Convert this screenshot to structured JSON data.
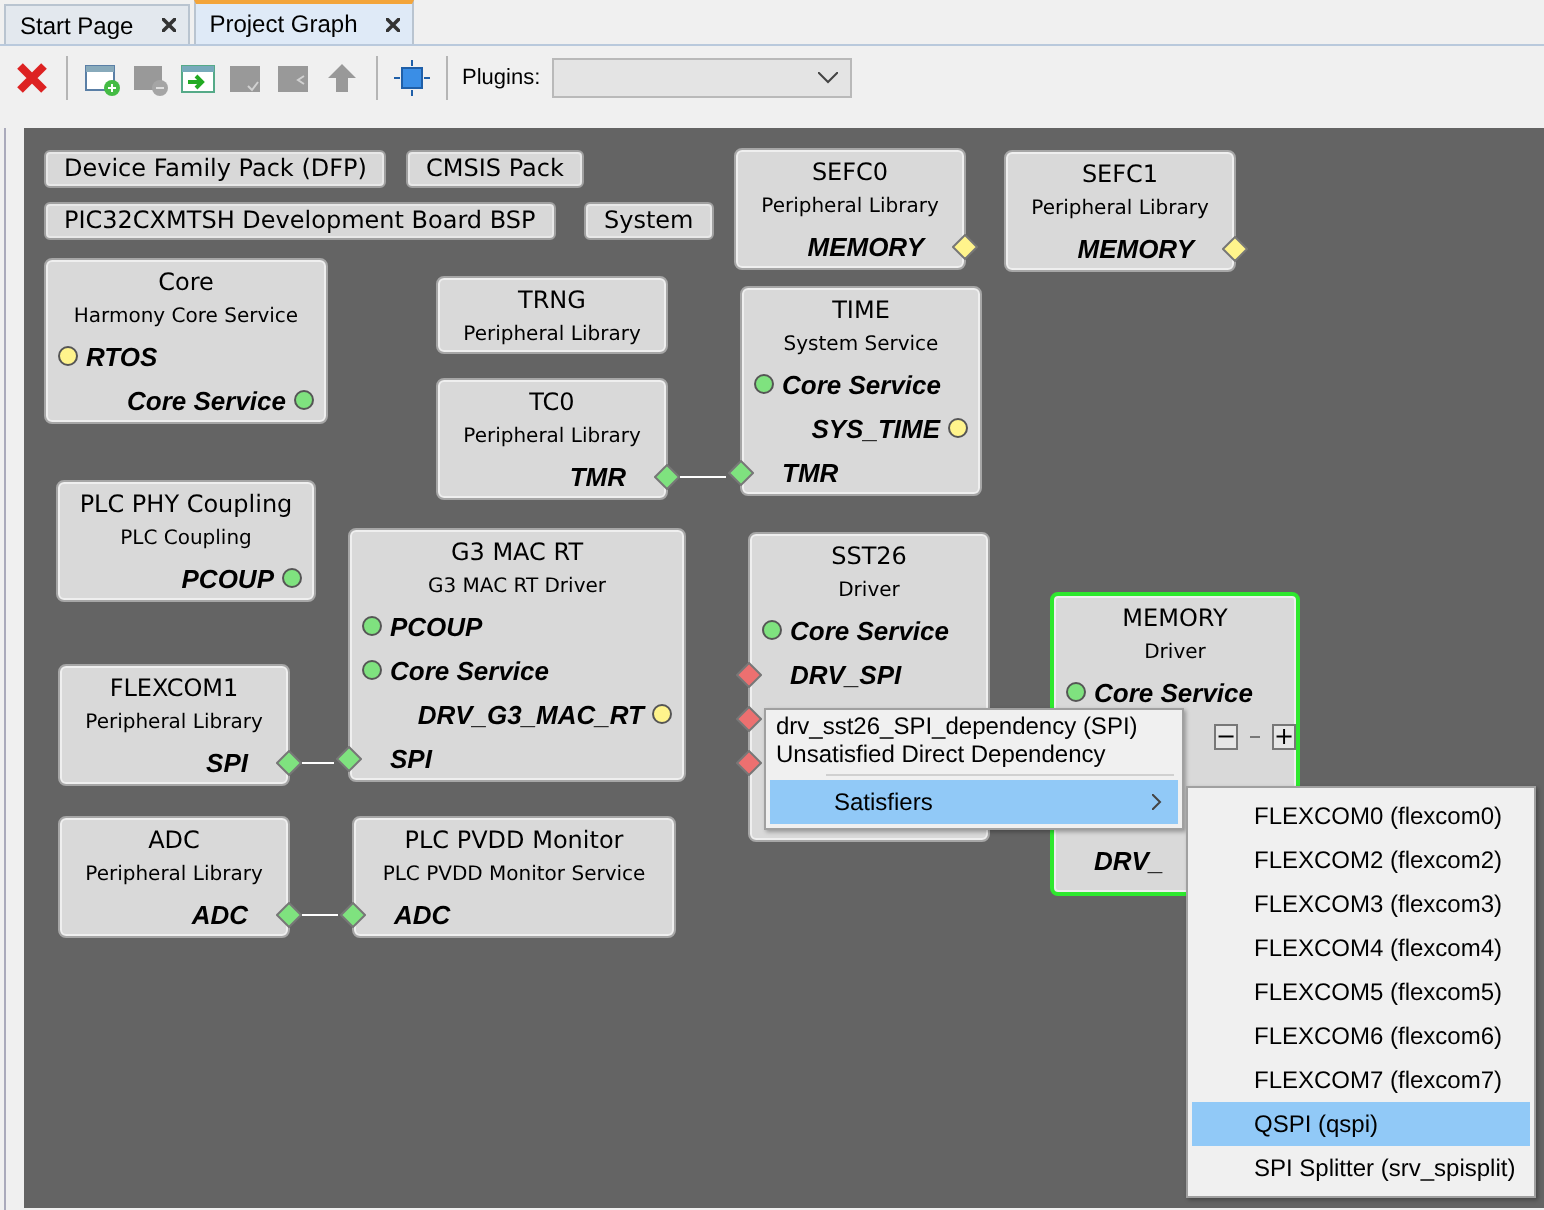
{
  "tabs": [
    {
      "label": "Start Page",
      "selected": false
    },
    {
      "label": "Project Graph",
      "selected": true
    }
  ],
  "toolbar": {
    "buttons": [
      {
        "kind": "delete",
        "disabled": false
      },
      {
        "kind": "add-window",
        "disabled": false
      },
      {
        "kind": "remove-window",
        "disabled": true
      },
      {
        "kind": "import-window",
        "disabled": false
      },
      {
        "kind": "check-window",
        "disabled": true
      },
      {
        "kind": "back-window",
        "disabled": true
      },
      {
        "kind": "up-arrow",
        "disabled": true
      },
      {
        "kind": "fit",
        "disabled": false
      }
    ],
    "plugins_label": "Plugins:"
  },
  "packs": [
    "Device Family Pack (DFP)",
    "CMSIS Pack",
    "PIC32CXMTSH Development Board BSP",
    "System"
  ],
  "nodes": [
    {
      "title": "SEFC0",
      "subtitle": "Peripheral Library",
      "selected": false,
      "ports": [
        {
          "label": "MEMORY",
          "kind": "plug",
          "color": "#fff48c"
        }
      ]
    },
    {
      "title": "SEFC1",
      "subtitle": "Peripheral Library",
      "selected": false,
      "ports": [
        {
          "label": "MEMORY",
          "kind": "plug",
          "color": "#fff48c"
        }
      ]
    },
    {
      "title": "Core",
      "subtitle": "Harmony Core Service",
      "selected": false,
      "ports": [
        {
          "label": "RTOS",
          "kind": "required",
          "color": "#fff48c"
        },
        {
          "label": "Core Service",
          "kind": "provided",
          "color": "#7fe27f"
        }
      ]
    },
    {
      "title": "TRNG",
      "subtitle": "Peripheral Library",
      "selected": false
    },
    {
      "title": "TC0",
      "subtitle": "Peripheral Library",
      "selected": false,
      "ports": [
        {
          "label": "TMR",
          "kind": "plug",
          "color": "#7fe27f",
          "linked": true
        }
      ]
    },
    {
      "title": "TIME",
      "subtitle": "System Service",
      "selected": false,
      "ports": [
        {
          "label": "Core Service",
          "kind": "required",
          "color": "#7fe27f"
        },
        {
          "label": "SYS_TIME",
          "kind": "provided",
          "color": "#fff48c"
        },
        {
          "label": "TMR",
          "kind": "socket",
          "color": "#7fe27f"
        }
      ]
    },
    {
      "title": "PLC PHY Coupling",
      "subtitle": "PLC Coupling",
      "selected": false,
      "ports": [
        {
          "label": "PCOUP",
          "kind": "provided",
          "color": "#7fe27f"
        }
      ]
    },
    {
      "title": "FLEXCOM1",
      "subtitle": "Peripheral Library",
      "selected": false,
      "ports": [
        {
          "label": "SPI",
          "kind": "plug",
          "color": "#7fe27f",
          "linked": true
        }
      ]
    },
    {
      "title": "G3 MAC RT",
      "subtitle": "G3 MAC RT Driver",
      "selected": false,
      "ports": [
        {
          "label": "PCOUP",
          "kind": "required",
          "color": "#7fe27f"
        },
        {
          "label": "Core Service",
          "kind": "required",
          "color": "#7fe27f"
        },
        {
          "label": "DRV_G3_MAC_RT",
          "kind": "provided",
          "color": "#fff48c"
        },
        {
          "label": "SPI",
          "kind": "socket",
          "color": "#7fe27f"
        }
      ]
    },
    {
      "title": "SST26",
      "subtitle": "Driver",
      "selected": false,
      "ports": [
        {
          "label": "Core Service",
          "kind": "required",
          "color": "#7fe27f"
        },
        {
          "label": "DRV_SPI",
          "kind": "socket",
          "color": "#ec7070"
        },
        {
          "kind": "socket",
          "color": "#ec7070"
        },
        {
          "kind": "socket",
          "color": "#ec7070"
        }
      ]
    },
    {
      "title": "MEMORY",
      "subtitle": "Driver",
      "selected": true,
      "ports": [
        {
          "label": "Core Service",
          "kind": "required",
          "color": "#7fe27f"
        },
        {
          "kind": "stepper",
          "minus": "−",
          "plus": "+"
        },
        {
          "label": "DRV_",
          "kind": "text"
        }
      ]
    },
    {
      "title": "ADC",
      "subtitle": "Peripheral Library",
      "selected": false,
      "ports": [
        {
          "label": "ADC",
          "kind": "plug",
          "color": "#7fe27f",
          "linked": true
        }
      ]
    },
    {
      "title": "PLC PVDD Monitor",
      "subtitle": "PLC PVDD Monitor Service",
      "selected": false,
      "ports": [
        {
          "label": "ADC",
          "kind": "socket",
          "color": "#7fe27f"
        }
      ]
    }
  ],
  "context_menu": {
    "header": [
      "drv_sst26_SPI_dependency (SPI)",
      "Unsatisfied Direct Dependency"
    ],
    "items": [
      {
        "label": "Satisfiers",
        "selected": true,
        "submenu": true
      }
    ]
  },
  "submenu": {
    "items": [
      {
        "label": "FLEXCOM0 (flexcom0)",
        "selected": false
      },
      {
        "label": "FLEXCOM2 (flexcom2)",
        "selected": false
      },
      {
        "label": "FLEXCOM3 (flexcom3)",
        "selected": false
      },
      {
        "label": "FLEXCOM4 (flexcom4)",
        "selected": false
      },
      {
        "label": "FLEXCOM5 (flexcom5)",
        "selected": false
      },
      {
        "label": "FLEXCOM6 (flexcom6)",
        "selected": false
      },
      {
        "label": "FLEXCOM7 (flexcom7)",
        "selected": false
      },
      {
        "label": "QSPI (qspi)",
        "selected": true
      },
      {
        "label": "SPI Splitter (srv_spisplit)",
        "selected": false
      }
    ]
  }
}
